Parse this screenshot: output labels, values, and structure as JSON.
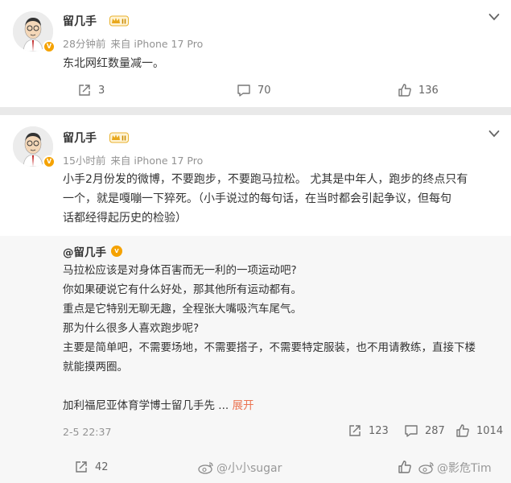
{
  "post1": {
    "author": "留几手",
    "meta_time": "28分钟前",
    "meta_source": "来自 iPhone 17 Pro",
    "text": "东北网红数量减一。",
    "reposts": "3",
    "comments": "70",
    "likes": "136"
  },
  "post2": {
    "author": "留几手",
    "meta_time": "15小时前",
    "meta_source": "来自 iPhone 17 Pro",
    "text_lines": [
      "小手2月份发的微博，不要跑步，不要跑马拉松。 尤其是中年人，跑步的终点只有",
      "一个，就是嘎嘣一下猝死。（小手说过的每句话，在当时都会引起争议，但每句",
      "话都经得起历史的检验）"
    ],
    "quote": {
      "author": "@留几手",
      "lines": [
        "马拉松应该是对身体百害而无一利的一项运动吧?",
        "你如果硬说它有什么好处，那其他所有运动都有。",
        "重点是它特别无聊无趣，全程张大嘴吸汽车尾气。",
        "那为什么很多人喜欢跑步呢?",
        "主要是简单吧，不需要场地，不需要搭子，不需要特定服装，也不用请教练，直接下楼",
        "就能摸两圈。"
      ],
      "last_line": "加利福尼亚体育学博士留几手先 ...",
      "expand": "展开",
      "time": "2-5 22:37",
      "reposts": "123",
      "comments": "287",
      "likes": "1014"
    },
    "reposts": "42"
  },
  "watermarks": {
    "left": "@小小sugar",
    "right": "@影危Tim"
  }
}
